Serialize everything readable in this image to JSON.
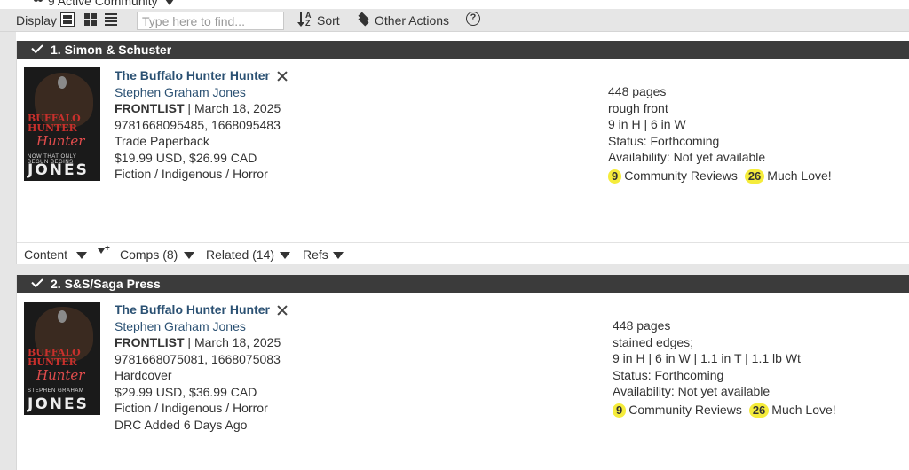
{
  "top_bar": {
    "community_label": "9 Active Community"
  },
  "toolbar": {
    "display_label": "Display",
    "search_placeholder": "Type here to find...",
    "sort_label": "Sort",
    "other_actions_label": "Other Actions",
    "help_glyph": "?"
  },
  "titles": [
    {
      "header": "1. Simon & Schuster",
      "title": "The Buffalo Hunter Hunter",
      "author": "Stephen Graham Jones",
      "list": "FRONTLIST",
      "date": " | March 18, 2025",
      "isbns": "9781668095485, 1668095483",
      "format": "Trade Paperback",
      "price": "$19.99 USD, $26.99 CAD",
      "category": "Fiction / Indigenous / Horror",
      "extra": "",
      "specs": [
        "448 pages",
        "rough front",
        "9 in H | 6 in W",
        "Status: Forthcoming",
        "Availability: Not yet available"
      ],
      "review_count": "9",
      "review_label": "Community Reviews",
      "love_count": "26",
      "love_label": "Much Love!",
      "cover": {
        "title_top": "BUFFALO HUNTER",
        "title_script": "Hunter",
        "tagline": "NOW THAT ONLY BEGUN BEGINS",
        "author_line": "JONES"
      }
    },
    {
      "header": "2. S&S/Saga Press",
      "title": "The Buffalo Hunter Hunter",
      "author": "Stephen Graham Jones",
      "list": "FRONTLIST",
      "date": " | March 18, 2025",
      "isbns": "9781668075081, 1668075083",
      "format": "Hardcover",
      "price": "$29.99 USD, $36.99 CAD",
      "category": "Fiction / Indigenous / Horror",
      "extra": "DRC Added 6 Days Ago",
      "specs": [
        "448 pages",
        "stained edges;",
        "9 in H | 6 in W | 1.1 in T | 1.1 lb Wt",
        "Status: Forthcoming",
        "Availability: Not yet available"
      ],
      "review_count": "9",
      "review_label": "Community Reviews",
      "love_count": "26",
      "love_label": "Much Love!",
      "cover": {
        "title_top": "BUFFALO HUNTER",
        "title_script": "Hunter",
        "tagline": "STEPHEN GRAHAM",
        "author_line": "JONES"
      }
    }
  ],
  "footer_tabs": {
    "content": "Content",
    "comps": "Comps (8)",
    "related": "Related (14)",
    "refs": "Refs"
  },
  "colors": {
    "header_bg": "#3b3b3b",
    "link_blue": "#2b5173",
    "badge_yellow": "#f5ec3b",
    "toolbar_bg": "#e6e6e6"
  }
}
